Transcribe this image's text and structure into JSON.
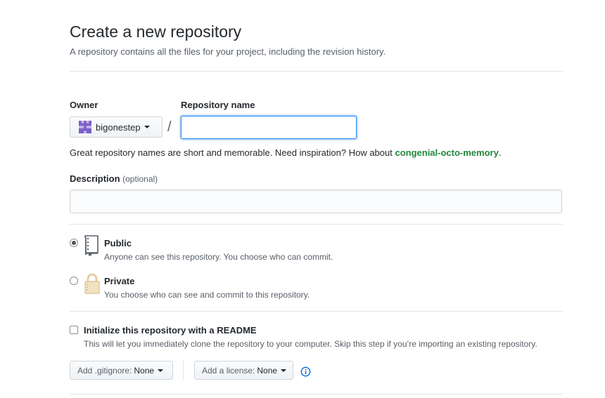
{
  "header": {
    "title": "Create a new repository",
    "subtitle": "A repository contains all the files for your project, including the revision history."
  },
  "owner": {
    "label": "Owner",
    "value": "bigonestep",
    "avatar_icon": "identicon-avatar"
  },
  "separator": "/",
  "repo_name": {
    "label": "Repository name",
    "value": "",
    "placeholder": ""
  },
  "hint": {
    "text": "Great repository names are short and memorable. Need inspiration? How about ",
    "suggestion": "congenial-octo-memory",
    "end": "."
  },
  "description": {
    "label": "Description",
    "optional": "(optional)",
    "value": "",
    "placeholder": ""
  },
  "visibility": {
    "selected": "public",
    "public": {
      "title": "Public",
      "desc": "Anyone can see this repository. You choose who can commit.",
      "icon": "repo-book-icon"
    },
    "private": {
      "title": "Private",
      "desc": "You choose who can see and commit to this repository.",
      "icon": "lock-icon"
    }
  },
  "readme": {
    "checked": false,
    "label": "Initialize this repository with a README",
    "desc": "This will let you immediately clone the repository to your computer. Skip this step if you’re importing an existing repository."
  },
  "gitignore": {
    "label": "Add .gitignore:",
    "value": "None"
  },
  "license": {
    "label": "Add a license:",
    "value": "None"
  },
  "colors": {
    "accent_blue": "#0366d6",
    "suggestion_green": "#22863a",
    "border": "#d1d5da",
    "muted_text": "#586069"
  }
}
